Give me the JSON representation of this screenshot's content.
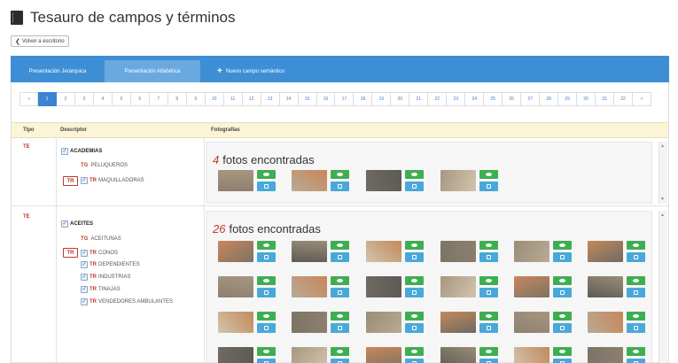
{
  "header": {
    "title": "Tesauro de campos y términos"
  },
  "back_button": {
    "label": "Volver a escritorio"
  },
  "tabs": [
    {
      "label": "Presentación Jerárquica",
      "active": false
    },
    {
      "label": "Presentación Alfabética",
      "active": true
    },
    {
      "label": "Nuevo campo semántico",
      "active": false
    }
  ],
  "pagination": {
    "prev": "«",
    "next": "»",
    "pages": [
      "1",
      "2",
      "3",
      "4",
      "5",
      "6",
      "7",
      "8",
      "9",
      "10",
      "11",
      "12",
      "13",
      "14",
      "15",
      "16",
      "17",
      "18",
      "19",
      "20",
      "21",
      "22",
      "23",
      "24",
      "25",
      "26",
      "27",
      "28",
      "29",
      "30",
      "31",
      "32"
    ],
    "current": "1"
  },
  "table": {
    "columns": {
      "tipo": "Tipo",
      "descriptor": "Descriptor",
      "fotografias": "Fotografías"
    },
    "rows": [
      {
        "tipo": "TE",
        "term": "ACADEMIAS",
        "tg": {
          "code": "TG",
          "term": "PELUQUEROS"
        },
        "tr": [
          {
            "code": "TR",
            "term": "MAQUILLADORAS"
          }
        ],
        "tr_badge": "TR",
        "count": "4",
        "count_label": "fotos encontradas",
        "photos": 4
      },
      {
        "tipo": "TE",
        "term": "ACEITES",
        "tg": {
          "code": "TG",
          "term": "ACEITUNAS"
        },
        "tr": [
          {
            "code": "TR",
            "term": "CONOS"
          },
          {
            "code": "TR",
            "term": "DEPENDIENTES"
          },
          {
            "code": "TR",
            "term": "INDUSTRIAS"
          },
          {
            "code": "TR",
            "term": "TINAJAS"
          },
          {
            "code": "TR",
            "term": "VENDEDORES AMBULANTES"
          }
        ],
        "tr_badge": "TR",
        "count": "26",
        "count_label": "fotos encontradas",
        "photos": 26
      }
    ]
  },
  "colors": {
    "tab_bar": "#3e8ed6",
    "view_button": "#3fae52",
    "info_button": "#49a8d8",
    "term_code": "#c0392b",
    "table_header": "#fcf4d6"
  },
  "icons": {
    "title": "book-icon",
    "back": "chevron-left-icon",
    "new": "plus-icon",
    "view": "eye-icon",
    "info": "info-icon",
    "checkbox": "checkbox-checked-icon"
  }
}
